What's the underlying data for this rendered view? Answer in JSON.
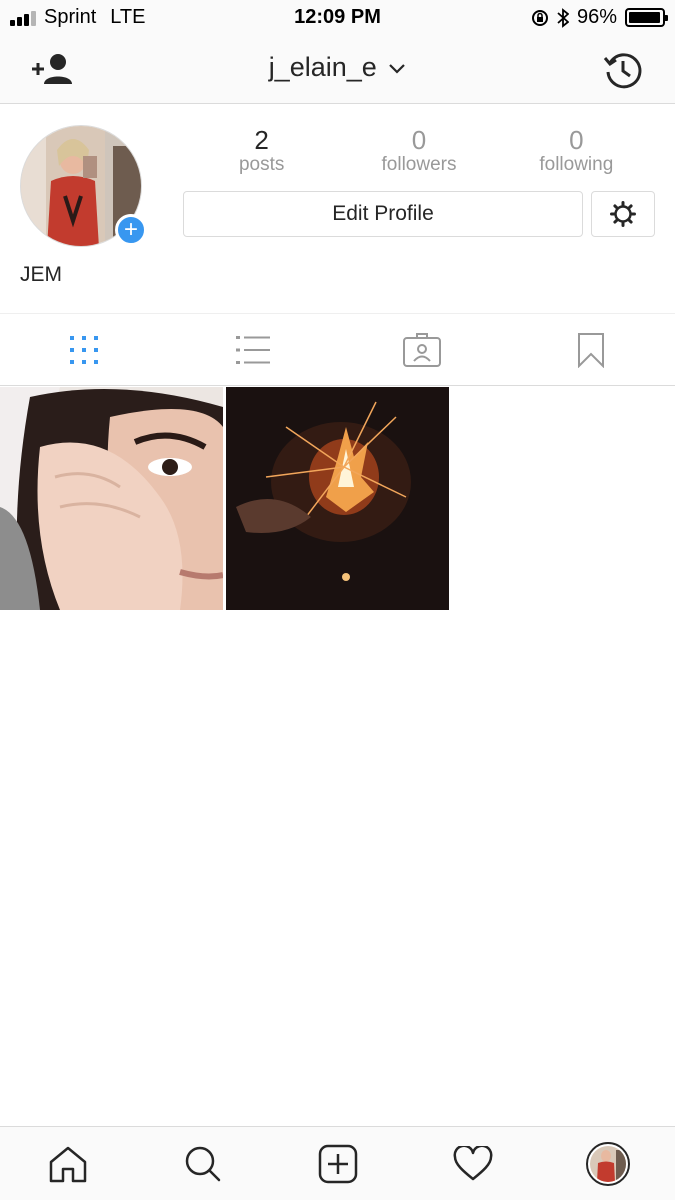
{
  "status_bar": {
    "carrier": "Sprint",
    "network": "LTE",
    "time": "12:09 PM",
    "battery_percent": "96%",
    "battery_level": 0.96,
    "signal_bars_active": 3,
    "signal_bars_total": 4
  },
  "header": {
    "username": "j_elain_e",
    "add_person_icon": "add-person-icon",
    "history_icon": "history-icon",
    "dropdown_icon": "chevron-down-icon"
  },
  "profile": {
    "display_name": "JEM",
    "stats": [
      {
        "value": "2",
        "label": "posts"
      },
      {
        "value": "0",
        "label": "followers"
      },
      {
        "value": "0",
        "label": "following"
      }
    ],
    "edit_label": "Edit Profile",
    "add_story_symbol": "+"
  },
  "tabs": [
    {
      "icon": "grid-icon",
      "active": true
    },
    {
      "icon": "list-icon",
      "active": false
    },
    {
      "icon": "tagged-icon",
      "active": false
    },
    {
      "icon": "saved-icon",
      "active": false
    }
  ],
  "posts": [
    {
      "description_icon": "photo-portrait"
    },
    {
      "description_icon": "photo-sparkler"
    }
  ],
  "bottom_nav": [
    {
      "icon": "home-icon"
    },
    {
      "icon": "search-icon"
    },
    {
      "icon": "new-post-icon"
    },
    {
      "icon": "activity-heart-icon"
    },
    {
      "icon": "profile-avatar-icon"
    }
  ],
  "colors": {
    "accent": "#3897f0",
    "text": "#262626",
    "muted": "#999999",
    "border": "#dbdbdb",
    "bar_background": "#fafafa"
  }
}
